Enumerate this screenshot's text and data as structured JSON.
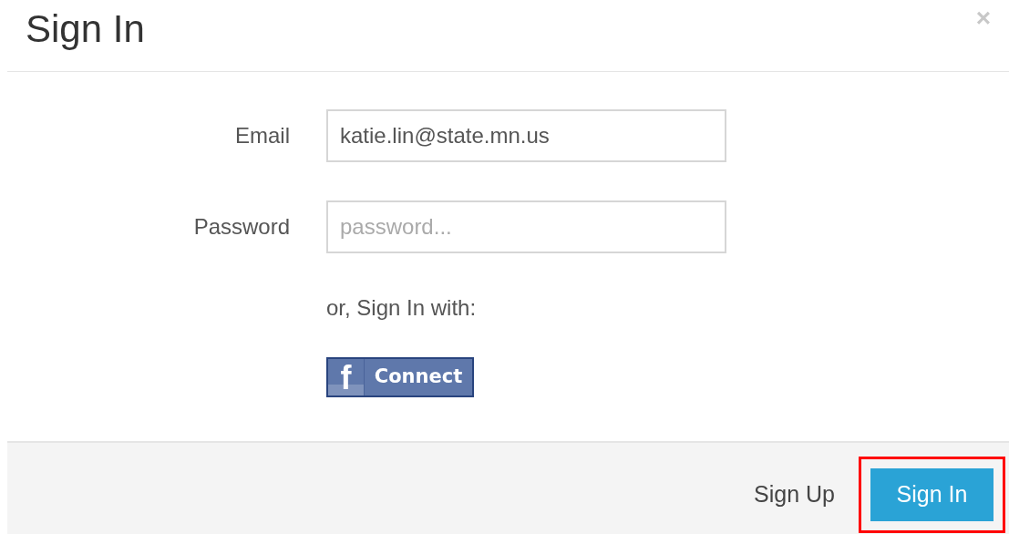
{
  "dialog": {
    "title": "Sign In",
    "close": "×"
  },
  "fields": [
    {
      "label": "Email",
      "value": "katie.lin@state.mn.us"
    },
    {
      "label": "Password",
      "placeholder": "password..."
    }
  ],
  "alt_sign_in": {
    "label": "or, Sign In with:",
    "facebook_button": {
      "icon": "f",
      "label": "Connect"
    }
  },
  "footer": {
    "link": "Sign Up",
    "button": {
      "label": "Sign In",
      "highlighted": true
    }
  }
}
